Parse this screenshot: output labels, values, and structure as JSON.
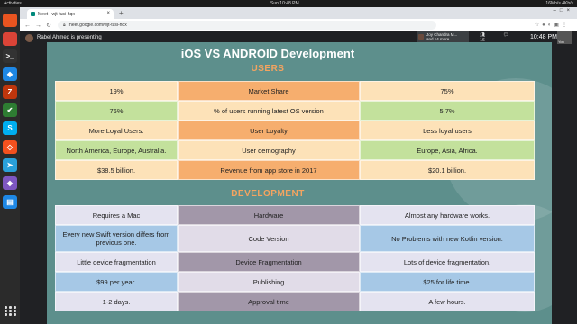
{
  "os_bar": {
    "activities": "Activities",
    "clock": "Sun 10:48 PM",
    "status": "16Mb/s  4Kb/s"
  },
  "dock": {
    "icons": [
      {
        "name": "ubuntu-icon",
        "color": "#e95420",
        "glyph": ""
      },
      {
        "name": "chrome-icon",
        "color": "#db4437",
        "glyph": ""
      },
      {
        "name": "terminal-icon",
        "color": "#333333",
        "glyph": ">_"
      },
      {
        "name": "vscode-icon",
        "color": "#1e88e5",
        "glyph": "◆"
      },
      {
        "name": "filezilla-icon",
        "color": "#bf360c",
        "glyph": "Z"
      },
      {
        "name": "app-icon",
        "color": "#2e7d32",
        "glyph": "✔"
      },
      {
        "name": "skype-icon",
        "color": "#00aff0",
        "glyph": "S"
      },
      {
        "name": "git-icon",
        "color": "#f4511e",
        "glyph": "◇"
      },
      {
        "name": "telegram-icon",
        "color": "#2aa1da",
        "glyph": "➤"
      },
      {
        "name": "app-icon-2",
        "color": "#7e57c2",
        "glyph": "◆"
      },
      {
        "name": "document-icon",
        "color": "#1e88e5",
        "glyph": "▤"
      }
    ]
  },
  "browser": {
    "tab_title": "Meet - wjt-tusi-hqx",
    "url": "meet.google.com/wjt-tusi-hqx"
  },
  "meet": {
    "presenter_text": "Rabel Ahmed is presenting",
    "participant_name": "Joy Chandra M...",
    "participant_more": "and 14 more",
    "people_count": "16",
    "time": "10:48 PM",
    "you_label": "You"
  },
  "slide": {
    "title": "iOS VS ANDROID Development",
    "users_heading": "USERS",
    "development_heading": "DEVELOPMENT",
    "colors": {
      "ios_users": "#fde2b8",
      "ios_users_alt": "#c3e19c",
      "label_users": "#f6ae6e",
      "android_users": "#fde2b8",
      "android_users_alt": "#c3e19c",
      "ios_dev": "#e4e3f0",
      "ios_dev_alt": "#a6c8e6",
      "label_dev": "#a297a9",
      "label_dev_alt": "#e1dce8"
    },
    "users_rows": [
      {
        "ios": "19%",
        "label": "Market Share",
        "android": "75%"
      },
      {
        "ios": "76%",
        "label": "% of users running latest OS version",
        "android": "5.7%"
      },
      {
        "ios": "More Loyal Users.",
        "label": "User Loyalty",
        "android": "Less loyal users"
      },
      {
        "ios": "North America, Europe, Australia.",
        "label": "User demography",
        "android": "Europe, Asia, Africa."
      },
      {
        "ios": "$38.5 billion.",
        "label": "Revenue from app store in 2017",
        "android": "$20.1 billion."
      }
    ],
    "dev_rows": [
      {
        "ios": "Requires a Mac",
        "label": "Hardware",
        "android": "Almost any hardware works."
      },
      {
        "ios": "Every new Swift version differs from previous one.",
        "label": "Code Version",
        "android": "No Problems with new Kotlin version."
      },
      {
        "ios": "Little device fragmentation",
        "label": "Device Fragmentation",
        "android": "Lots of device fragmentation."
      },
      {
        "ios": "$99 per year.",
        "label": "Publishing",
        "android": "$25 for life time."
      },
      {
        "ios": "1-2 days.",
        "label": "Approval time",
        "android": "A few hours."
      }
    ]
  }
}
